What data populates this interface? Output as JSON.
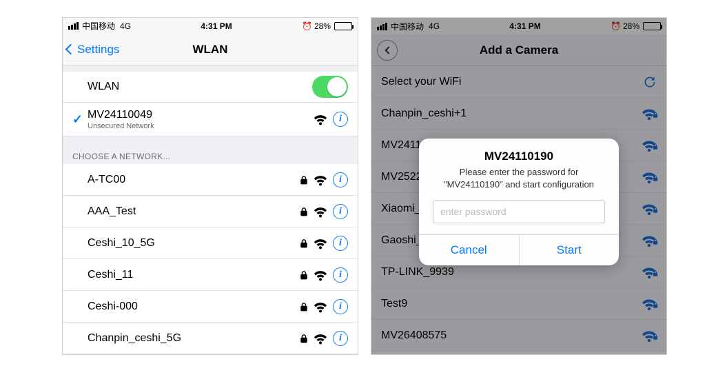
{
  "left": {
    "status": {
      "carrier": "中国移动",
      "net": "4G",
      "time": "4:31 PM",
      "battery_pct": "28%"
    },
    "nav": {
      "back_label": "Settings",
      "title": "WLAN"
    },
    "wlan_row_label": "WLAN",
    "connected": {
      "ssid": "MV24110049",
      "subtitle": "Unsecured Network"
    },
    "choose_header": "CHOOSE A NETWORK...",
    "networks": [
      {
        "ssid": "A-TC00"
      },
      {
        "ssid": "AAA_Test"
      },
      {
        "ssid": "Ceshi_10_5G"
      },
      {
        "ssid": "Ceshi_11"
      },
      {
        "ssid": "Ceshi-000"
      },
      {
        "ssid": "Chanpin_ceshi_5G"
      }
    ]
  },
  "right": {
    "status": {
      "carrier": "中国移动",
      "net": "4G",
      "time": "4:31 PM",
      "battery_pct": "28%"
    },
    "nav": {
      "title": "Add a Camera"
    },
    "select_header": "Select your WiFi",
    "networks": [
      {
        "ssid": "Chanpin_ceshi+1"
      },
      {
        "ssid": "MV2411"
      },
      {
        "ssid": "MV2522"
      },
      {
        "ssid": "Xiaomi_"
      },
      {
        "ssid": "Gaoshi_"
      },
      {
        "ssid": "TP-LINK_9939"
      },
      {
        "ssid": "Test9"
      },
      {
        "ssid": "MV26408575"
      }
    ],
    "modal": {
      "title": "MV24110190",
      "message": "Please enter the password for \"MV24110190\" and start configuration",
      "placeholder": "enter password",
      "cancel": "Cancel",
      "start": "Start"
    }
  }
}
